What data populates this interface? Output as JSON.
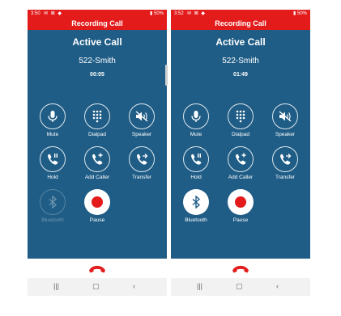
{
  "screens": [
    {
      "status": {
        "time": "3:50",
        "right": "50%"
      },
      "recording_label": "Recording Call",
      "title": "Active Call",
      "callee": "522-Smith",
      "timer": "00:05",
      "buttons": {
        "mute": "Mute",
        "dialpad": "Dialpad",
        "speaker": "Speaker",
        "hold": "Hold",
        "add_caller": "Add Caller",
        "transfer": "Transfer",
        "bluetooth": "Bluetooth",
        "pause": "Pause"
      },
      "bluetooth_enabled": false
    },
    {
      "status": {
        "time": "3:52",
        "right": "50%"
      },
      "recording_label": "Recording Call",
      "title": "Active Call",
      "callee": "522-Smith",
      "timer": "01:49",
      "buttons": {
        "mute": "Mute",
        "dialpad": "Dialpad",
        "speaker": "Speaker",
        "hold": "Hold",
        "add_caller": "Add Caller",
        "transfer": "Transfer",
        "bluetooth": "Bluetooth",
        "pause": "Pause"
      },
      "bluetooth_enabled": true
    }
  ],
  "colors": {
    "call_bg": "#1f5d86",
    "recording_bar": "#e31b1b",
    "end_call": "#e31b1b",
    "record_dot": "#e31b1b"
  },
  "icons": [
    "microphone-icon",
    "dialpad-icon",
    "speaker-muted-icon",
    "hold-icon",
    "add-caller-icon",
    "transfer-icon",
    "bluetooth-icon",
    "record-icon",
    "end-call-icon"
  ]
}
